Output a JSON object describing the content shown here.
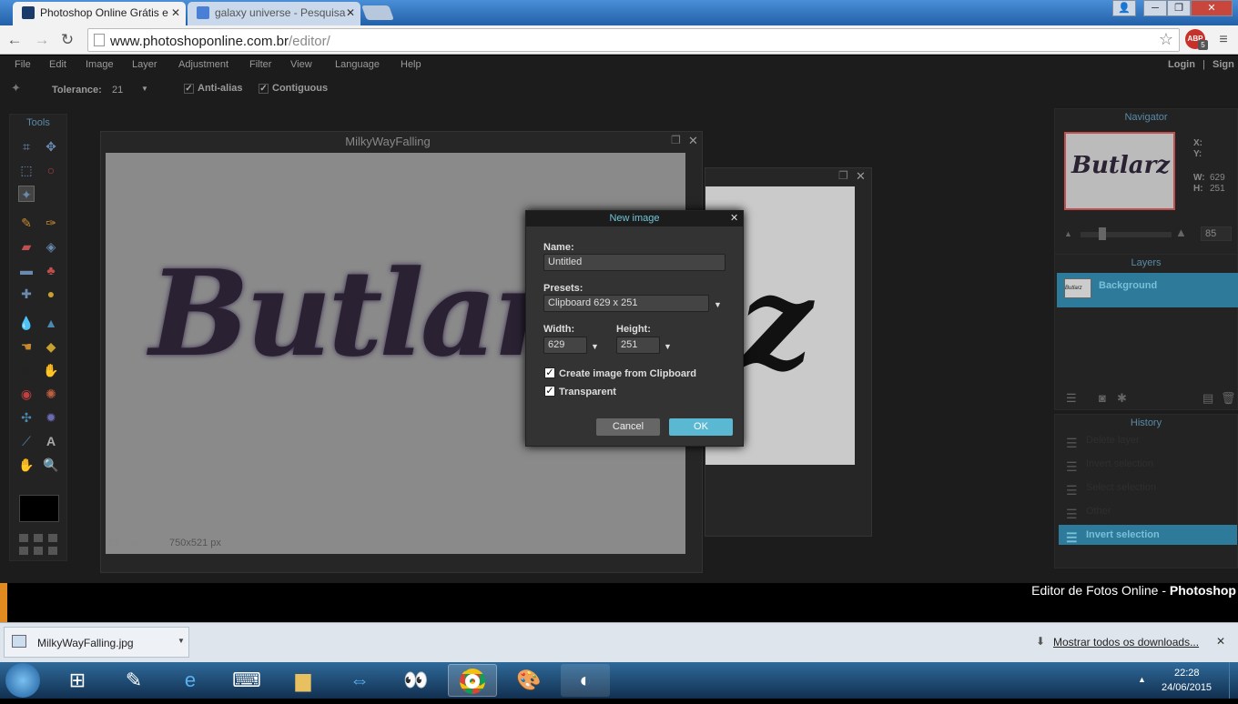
{
  "browser": {
    "tabs": [
      {
        "label": "Photoshop Online Grátis e"
      },
      {
        "label": "galaxy universe - Pesquisa"
      }
    ],
    "url_domain": "www.photoshoponline.com.br",
    "url_path": "/editor/",
    "abp_label": "ABP",
    "abp_count": "5"
  },
  "app": {
    "menu": [
      "File",
      "Edit",
      "Image",
      "Layer",
      "Adjustment",
      "Filter",
      "View",
      "Language",
      "Help"
    ],
    "login": "Login",
    "separator": "|",
    "signup": "Sign",
    "options": {
      "tolerance_label": "Tolerance:",
      "tolerance_value": "21",
      "antialias": "Anti-alias",
      "contiguous": "Contiguous"
    },
    "tools_title": "Tools",
    "canvas_window": {
      "title": "MilkyWayFalling",
      "zoom": "85",
      "zoom_unit": "%",
      "size": "750x521 px",
      "art_text": "Butlar"
    },
    "second_window": {
      "art_text": "z"
    },
    "navigator": {
      "title": "Navigator",
      "x_label": "X:",
      "y_label": "Y:",
      "w_label": "W:",
      "w_value": "629",
      "h_label": "H:",
      "h_value": "251",
      "zoom": "85",
      "thumb_text": "Butlarz"
    },
    "layers": {
      "title": "Layers",
      "items": [
        {
          "name": "Background",
          "thumb": "Butlarz"
        }
      ]
    },
    "history": {
      "title": "History",
      "items": [
        "Delete layer",
        "Invert selection",
        "Select selection",
        "Other",
        "Invert selection"
      ],
      "selected_index": 4
    },
    "footer_text_normal": "Editor de Fotos Online - ",
    "footer_text_bold": "Photoshop"
  },
  "dialog": {
    "title": "New image",
    "name_label": "Name:",
    "name_value": "Untitled",
    "presets_label": "Presets:",
    "presets_value": "Clipboard 629 x 251",
    "width_label": "Width:",
    "width_value": "629",
    "height_label": "Height:",
    "height_value": "251",
    "clipboard_option": "Create image from Clipboard",
    "transparent_option": "Transparent",
    "cancel": "Cancel",
    "ok": "OK",
    "accent": "#5bb8d3"
  },
  "downloads": {
    "file": "MilkyWayFalling.jpg",
    "show_all": "Mostrar todos os downloads..."
  },
  "taskbar": {
    "time": "22:28",
    "date": "24/06/2015"
  }
}
